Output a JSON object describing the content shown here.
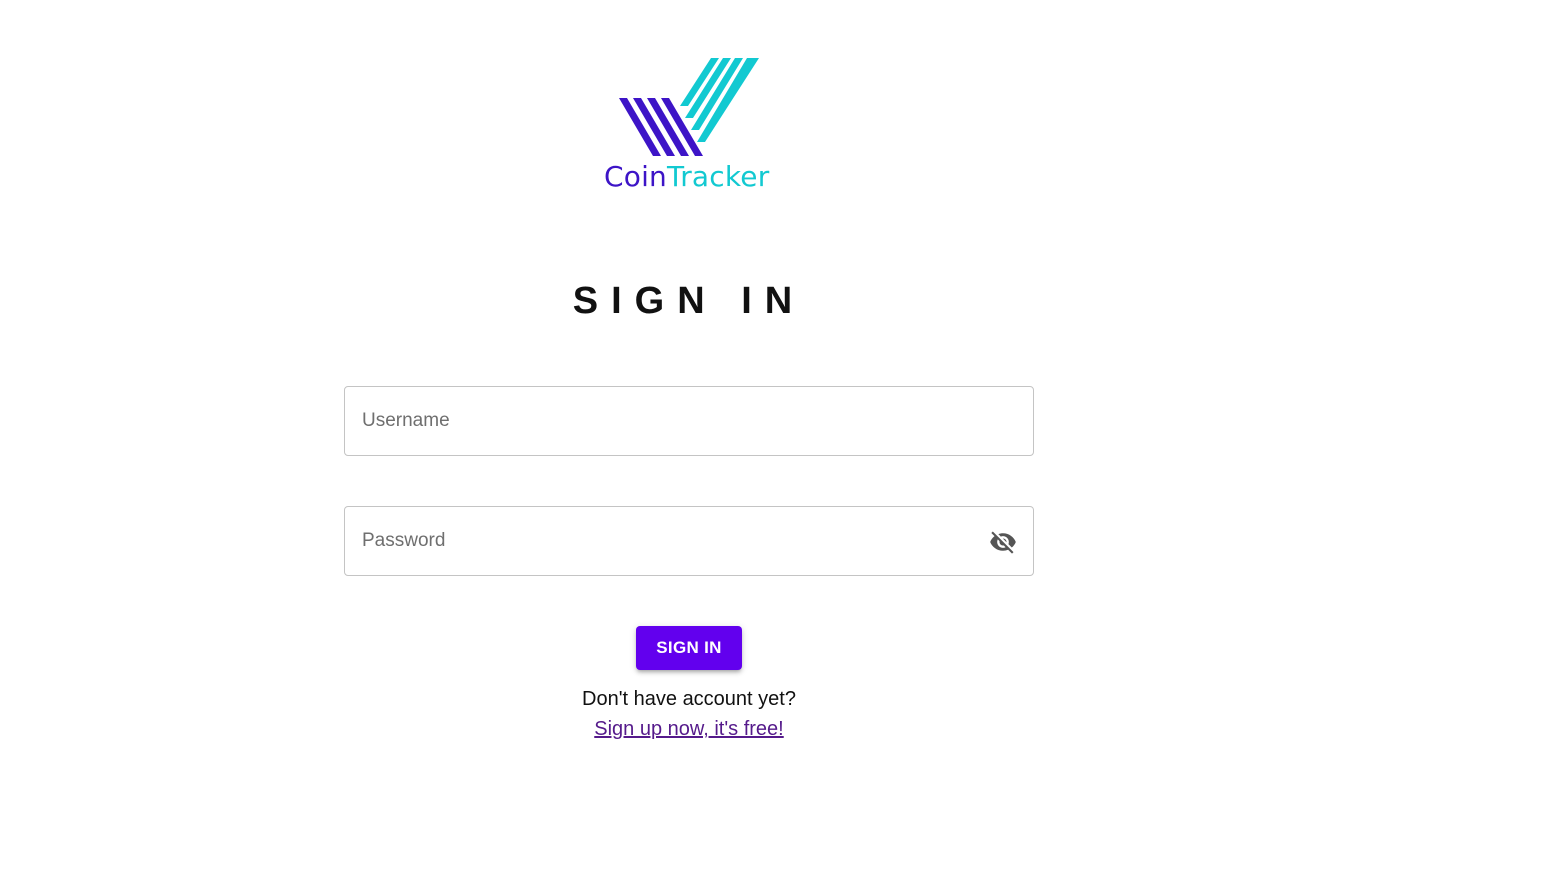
{
  "brand": {
    "name_part1": "Coin",
    "name_part2": "Tracker",
    "color_primary": "#3d14c7",
    "color_secondary": "#12c9d1",
    "logo_icon": "coin-tracker-check-logo"
  },
  "form": {
    "title": "SIGN IN",
    "username_placeholder": "Username",
    "password_placeholder": "Password",
    "password_toggle_icon": "eye-off-icon",
    "submit_label": "SIGN IN",
    "submit_color": "#6200ee"
  },
  "footer": {
    "prompt": "Don't have account yet?",
    "signup_link": "Sign up now, it's free!"
  }
}
